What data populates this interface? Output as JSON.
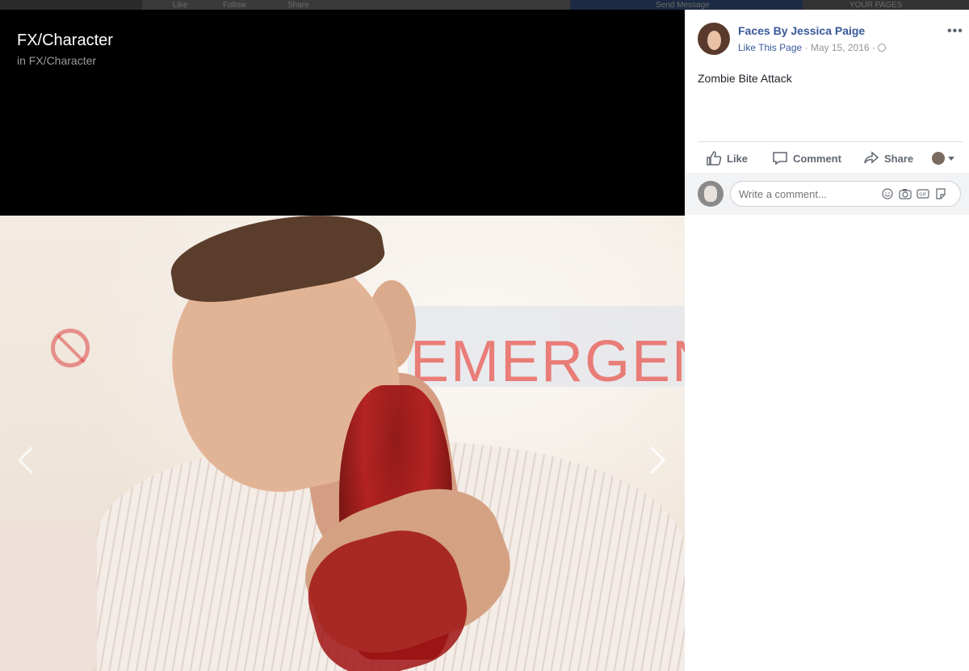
{
  "topbar": {
    "like": "Like",
    "follow": "Follow",
    "share": "Share",
    "send_message": "Send Message",
    "your_pages": "YOUR PAGES"
  },
  "album": {
    "title": "FX/Character",
    "subtitle": "in FX/Character"
  },
  "photo": {
    "sign_text": "EMERGENC"
  },
  "post": {
    "page_name": "Faces By Jessica Paige",
    "like_page": "Like This Page",
    "date": "May 15, 2016",
    "separator": "·",
    "text": "Zombie Bite Attack"
  },
  "actions": {
    "like": "Like",
    "comment": "Comment",
    "share": "Share"
  },
  "comment": {
    "placeholder": "Write a comment..."
  },
  "icons": [
    "prev-arrow-icon",
    "next-arrow-icon",
    "more-icon",
    "globe-icon",
    "like-icon",
    "comment-icon",
    "share-icon",
    "emoji-icon",
    "camera-icon",
    "gif-icon",
    "sticker-icon"
  ]
}
